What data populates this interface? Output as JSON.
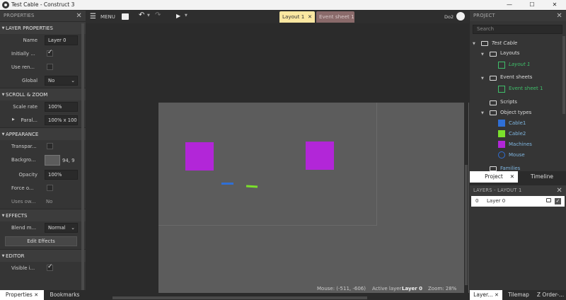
{
  "window": {
    "title": "Test Cable - Construct 3",
    "min": "—",
    "max": "☐",
    "close": "✕"
  },
  "properties": {
    "header": "PROPERTIES",
    "layer_section": "LAYER PROPERTIES",
    "name_label": "Name",
    "name_value": "Layer 0",
    "initially_label": "Initially ...",
    "use_ren_label": "Use ren...",
    "global_label": "Global",
    "global_value": "No",
    "scroll_section": "SCROLL & ZOOM",
    "scale_label": "Scale rate",
    "scale_value": "100%",
    "parallax_label": "Paral...",
    "parallax_value": "100% x 100",
    "appearance_section": "APPEARANCE",
    "transparent_label": "Transpar...",
    "background_label": "Backgro...",
    "background_value": "94, 9",
    "opacity_label": "Opacity",
    "opacity_value": "100%",
    "force_label": "Force o...",
    "uses_label": "Uses ow...",
    "uses_value": "No",
    "effects_section": "EFFECTS",
    "blend_label": "Blend m...",
    "blend_value": "Normal",
    "edit_effects": "Edit Effects",
    "editor_section": "EDITOR",
    "visible_label": "Visible i..."
  },
  "left_tabs": {
    "properties": "Properties",
    "bookmarks": "Bookmarks"
  },
  "toolbar": {
    "menu": "MENU",
    "tab_layout": "Layout 1",
    "tab_events": "Event sheet 1",
    "user": "Do2"
  },
  "status": {
    "mouse": "Mouse: (-511, -606)",
    "active_layer_label": "Active layer:",
    "active_layer": "Layer 0",
    "zoom": "Zoom: 28%"
  },
  "project": {
    "header": "PROJECT",
    "search_placeholder": "Search",
    "root": "Test Cable",
    "layouts": "Layouts",
    "layout1": "Layout 1",
    "event_sheets": "Event sheets",
    "event_sheet1": "Event sheet 1",
    "scripts": "Scripts",
    "object_types": "Object types",
    "cable1": "Cable1",
    "cable2": "Cable2",
    "machines": "Machines",
    "mouse": "Mouse",
    "families": "Families",
    "tab_project": "Project",
    "tab_timeline": "Timeline"
  },
  "layers": {
    "header": "LAYERS - LAYOUT 1",
    "row_index": "0",
    "row_name": "Layer 0"
  },
  "right_tabs": {
    "layers": "Layer...",
    "tilemap": "Tilemap",
    "zorder": "Z Order-..."
  },
  "colors": {
    "machines": "#b226d8",
    "cable1": "#2f6fd6",
    "cable2": "#7be02c",
    "layout_bg": "#5c5c5c",
    "tab_active": "#fbe7a1"
  }
}
